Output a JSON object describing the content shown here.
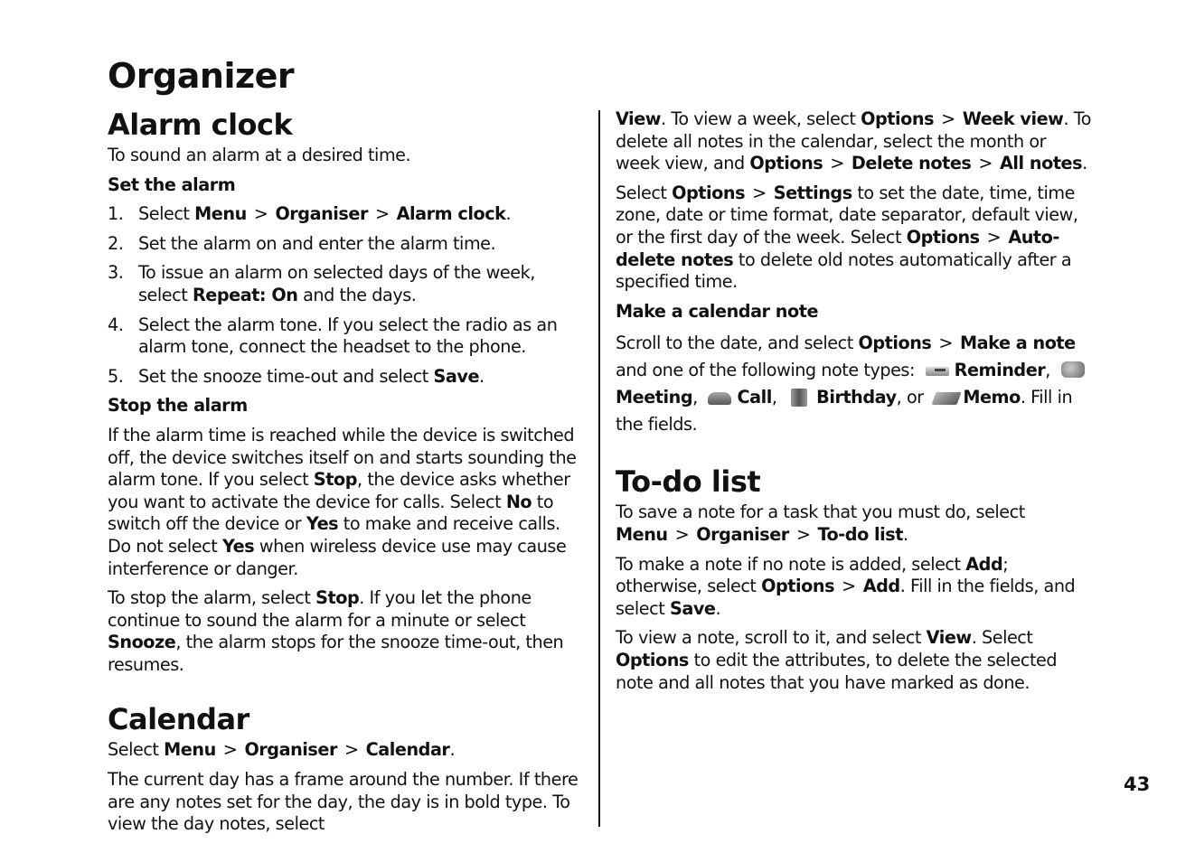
{
  "page_title": "Organizer",
  "page_number": "43",
  "alarm_clock": {
    "heading": "Alarm clock",
    "intro": "To sound an alarm at a desired time.",
    "set_heading": "Set the alarm",
    "steps": [
      {
        "num": "1.",
        "pre": "Select ",
        "path": [
          "Menu",
          "Organiser",
          "Alarm clock"
        ],
        "post": "."
      },
      {
        "num": "2.",
        "text": "Set the alarm on and enter the alarm time."
      },
      {
        "num": "3.",
        "pre": "To issue an alarm on selected days of the week, select ",
        "bold": "Repeat: On",
        "post": " and the days."
      },
      {
        "num": "4.",
        "text": "Select the alarm tone. If you select the radio as an alarm tone, connect the headset to the phone."
      },
      {
        "num": "5.",
        "pre": "Set the snooze time-out and select ",
        "bold": "Save",
        "post": "."
      }
    ],
    "stop_heading": "Stop the alarm",
    "stop_p1": [
      "If the alarm time is reached while the device is switched off, the device switches itself on and starts sounding the alarm tone. If you select ",
      "Stop",
      ", the device asks whether you want to activate the device for calls. Select ",
      "No",
      " to switch off the device or ",
      "Yes",
      " to make and receive calls. Do not select ",
      "Yes",
      " when wireless device use may cause interference or danger."
    ],
    "stop_p2": [
      "To stop the alarm, select ",
      "Stop",
      ". If you let the phone continue to sound the alarm for a minute or select ",
      "Snooze",
      ", the alarm stops for the snooze time-out, then resumes."
    ]
  },
  "calendar": {
    "heading": "Calendar",
    "select_pre": "Select ",
    "path": [
      "Menu",
      "Organiser",
      "Calendar"
    ],
    "select_post": ".",
    "p1": "The current day has a frame around the number. If there are any notes set for the day, the day is in bold type. To view the day notes, select ",
    "p1_parts": [
      "View",
      ". To view a week, select ",
      "Options",
      "Week view",
      ". To delete all notes in the calendar, select the month or week view, and ",
      "Options",
      "Delete notes",
      "All notes",
      "."
    ],
    "p2_parts": [
      "Select ",
      "Options",
      "Settings",
      " to set the date, time, time zone, date or time format, date separator, default view, or the first day of the week. Select ",
      "Options",
      "Auto-delete notes",
      " to delete old notes automatically after a specified time."
    ],
    "make_heading": "Make a calendar note",
    "make_parts": [
      "Scroll to the date, and select ",
      "Options",
      "Make a note",
      " and one of the following note types: "
    ],
    "note_types": [
      {
        "icon": "reminder-icon",
        "label": "Reminder",
        "after": ", "
      },
      {
        "icon": "meeting-icon",
        "label": "Meeting",
        "after": ", "
      },
      {
        "icon": "call-icon",
        "label": "Call",
        "after": ", "
      },
      {
        "icon": "birthday-icon",
        "label": "Birthday",
        "after": ", or"
      },
      {
        "icon": "memo-icon",
        "label": "Memo",
        "after": ". Fill in the fields."
      }
    ]
  },
  "todo": {
    "heading": "To-do list",
    "p1_pre": "To save a note for a task that you must do, select",
    "p1_path": [
      "Menu",
      "Organiser",
      "To-do list"
    ],
    "p1_post": ".",
    "p2_parts": [
      "To make a note if no note is added, select ",
      "Add",
      "; otherwise, select ",
      "Options",
      "Add",
      ". Fill in the fields, and select ",
      "Save",
      "."
    ],
    "p3_parts": [
      "To view a note, scroll to it, and select ",
      "View",
      ". Select ",
      "Options",
      " to edit the attributes, to delete the selected note and all notes that you have marked as done."
    ]
  },
  "separator": ">"
}
